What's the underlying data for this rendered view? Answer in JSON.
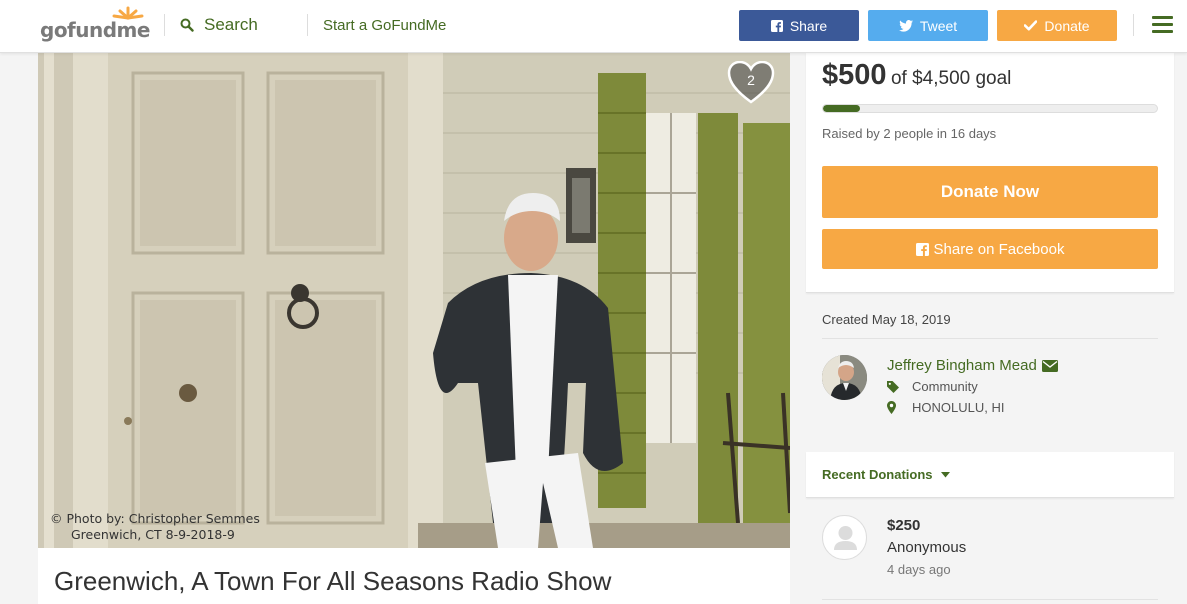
{
  "header": {
    "logo": "gofundme",
    "search_label": "Search",
    "start_link": "Start a GoFundMe",
    "share_label": "Share",
    "tweet_label": "Tweet",
    "donate_label": "Donate"
  },
  "photo": {
    "credit_line1": "© Photo by: Christopher Semmes",
    "credit_line2": "Greenwich, CT 8-9-2018-9",
    "heart_count": "2"
  },
  "campaign": {
    "title": "Greenwich, A Town For All Seasons Radio Show"
  },
  "funding": {
    "raised": "$500",
    "goal_text": "of $4,500 goal",
    "progress_fraction": 0.111,
    "raised_sub": "Raised by 2 people in 16 days",
    "donate_now": "Donate Now",
    "share_facebook": "Share on Facebook"
  },
  "organizer": {
    "created": "Created May 18, 2019",
    "name": "Jeffrey Bingham Mead",
    "category": "Community",
    "location": "HONOLULU, HI"
  },
  "recent": {
    "label": "Recent Donations",
    "donations": [
      {
        "amount": "$250",
        "name": "Anonymous",
        "time": "4 days ago"
      }
    ]
  },
  "colors": {
    "brand_green": "#456b23",
    "orange": "#f7a844",
    "facebook": "#3b5998",
    "twitter": "#55acee"
  }
}
